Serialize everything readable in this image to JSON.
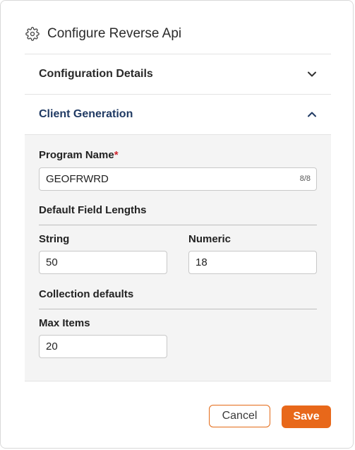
{
  "dialog": {
    "title": "Configure Reverse Api",
    "header_icon": "gear-icon"
  },
  "sections": {
    "configuration_details": {
      "label": "Configuration Details",
      "state": "collapsed",
      "icon": "chevron-down-icon"
    },
    "client_generation": {
      "label": "Client Generation",
      "state": "expanded",
      "icon": "chevron-up-icon"
    }
  },
  "client_generation": {
    "program_name": {
      "label": "Program Name",
      "required_mark": "*",
      "value": "GEOFRWRD",
      "counter": "8/8"
    },
    "default_field_lengths": {
      "heading": "Default Field Lengths",
      "string": {
        "label": "String",
        "value": "50"
      },
      "numeric": {
        "label": "Numeric",
        "value": "18"
      }
    },
    "collection_defaults": {
      "heading": "Collection defaults",
      "max_items": {
        "label": "Max Items",
        "value": "20"
      }
    }
  },
  "footer": {
    "cancel_label": "Cancel",
    "save_label": "Save"
  },
  "colors": {
    "accent_orange": "#e8681a",
    "section_active_blue": "#203a63",
    "required_red": "#d0262f",
    "panel_bg": "#f4f4f4"
  }
}
